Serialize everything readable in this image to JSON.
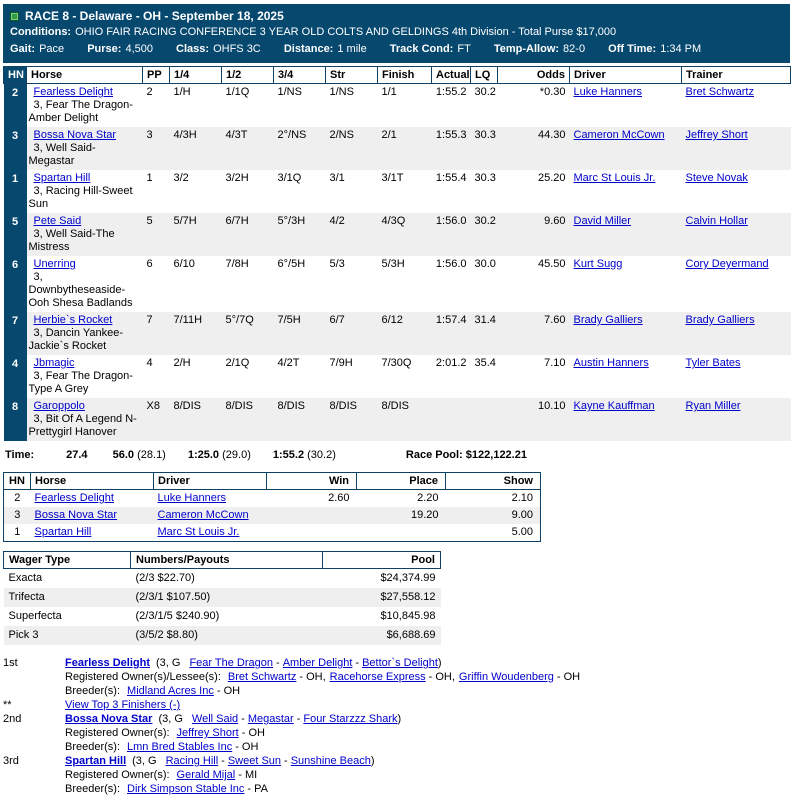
{
  "colors": {
    "navy": "#07486f",
    "link_blue": "#0000cc",
    "alt_row": "#efefef",
    "green_marker": "#2f9e43"
  },
  "header": {
    "race_title": "RACE 8 - Delaware - OH - September 18, 2025",
    "conditions_label": "Conditions:",
    "conditions": "OHIO FAIR RACING CONFERENCE 3 YEAR OLD COLTS AND GELDINGS 4th Division - Total Purse $17,000",
    "info": [
      {
        "label": "Gait:",
        "value": "Pace"
      },
      {
        "label": "Purse:",
        "value": "4,500"
      },
      {
        "label": "Class:",
        "value": "OHFS 3C"
      },
      {
        "label": "Distance:",
        "value": "1 mile"
      },
      {
        "label": "Track Cond:",
        "value": "FT"
      },
      {
        "label": "Temp-Allow:",
        "value": "82-0"
      },
      {
        "label": "Off Time:",
        "value": "1:34 PM"
      }
    ]
  },
  "results": {
    "headers": {
      "hn": "HN",
      "horse": "Horse",
      "pp": "PP",
      "q1": "1/4",
      "q2": "1/2",
      "q3": "3/4",
      "str": "Str",
      "finish": "Finish",
      "actual": "Actual",
      "lq": "LQ",
      "odds": "Odds",
      "driver": "Driver",
      "trainer": "Trainer"
    },
    "rows": [
      {
        "hn": "2",
        "name": "Fearless Delight",
        "ped": "3, Fear The Dragon-Amber Delight",
        "pp": "2",
        "q1": "1/H",
        "q2": "1/1Q",
        "q3": "1/NS",
        "str": "1/NS",
        "finish": "1/1",
        "actual": "1:55.2",
        "lq": "30.2",
        "odds": "*0.30",
        "driver": "Luke Hanners",
        "trainer": "Bret Schwartz"
      },
      {
        "hn": "3",
        "name": "Bossa Nova Star",
        "ped": "3, Well Said-Megastar",
        "pp": "3",
        "q1": "4/3H",
        "q2": "4/3T",
        "q3": "2°/NS",
        "str": "2/NS",
        "finish": "2/1",
        "actual": "1:55.3",
        "lq": "30.3",
        "odds": "44.30",
        "driver": "Cameron McCown",
        "trainer": "Jeffrey Short"
      },
      {
        "hn": "1",
        "name": "Spartan Hill",
        "ped": "3, Racing Hill-Sweet Sun",
        "pp": "1",
        "q1": "3/2",
        "q2": "3/2H",
        "q3": "3/1Q",
        "str": "3/1",
        "finish": "3/1T",
        "actual": "1:55.4",
        "lq": "30.3",
        "odds": "25.20",
        "driver": "Marc St Louis Jr.",
        "trainer": "Steve Novak"
      },
      {
        "hn": "5",
        "name": "Pete Said",
        "ped": "3, Well Said-The Mistress",
        "pp": "5",
        "q1": "5/7H",
        "q2": "6/7H",
        "q3": "5°/3H",
        "str": "4/2",
        "finish": "4/3Q",
        "actual": "1:56.0",
        "lq": "30.2",
        "odds": "9.60",
        "driver": "David Miller",
        "trainer": "Calvin Hollar"
      },
      {
        "hn": "6",
        "name": "Unerring",
        "ped": "3, Downbytheseaside-Ooh Shesa Badlands",
        "pp": "6",
        "q1": "6/10",
        "q2": "7/8H",
        "q3": "6°/5H",
        "str": "5/3",
        "finish": "5/3H",
        "actual": "1:56.0",
        "lq": "30.0",
        "odds": "45.50",
        "driver": "Kurt Sugg",
        "trainer": "Cory Deyermand"
      },
      {
        "hn": "7",
        "name": "Herbie`s Rocket",
        "ped": "3, Dancin Yankee-Jackie`s Rocket",
        "pp": "7",
        "q1": "7/11H",
        "q2": "5°/7Q",
        "q3": "7/5H",
        "str": "6/7",
        "finish": "6/12",
        "actual": "1:57.4",
        "lq": "31.4",
        "odds": "7.60",
        "driver": "Brady Galliers",
        "trainer": "Brady Galliers"
      },
      {
        "hn": "4",
        "name": "Jbmagic",
        "ped": "3, Fear The Dragon-Type A Grey",
        "pp": "4",
        "q1": "2/H",
        "q2": "2/1Q",
        "q3": "4/2T",
        "str": "7/9H",
        "finish": "7/30Q",
        "actual": "2:01.2",
        "lq": "35.4",
        "odds": "7.10",
        "driver": "Austin Hanners",
        "trainer": "Tyler Bates"
      },
      {
        "hn": "8",
        "name": "Garoppolo",
        "ped": "3, Bit Of A Legend N-Prettygirl Hanover",
        "pp": "X8",
        "q1": "8/DIS",
        "q2": "8/DIS",
        "q3": "8/DIS",
        "str": "8/DIS",
        "finish": "8/DIS",
        "actual": "",
        "lq": "",
        "odds": "10.10",
        "driver": "Kayne Kauffman",
        "trainer": "Ryan Miller"
      }
    ]
  },
  "time_row": {
    "label": "Time:",
    "splits": [
      {
        "t": "27.4",
        "s": ""
      },
      {
        "t": "56.0",
        "s": "(28.1)"
      },
      {
        "t": "1:25.0",
        "s": "(29.0)"
      },
      {
        "t": "1:55.2",
        "s": "(30.2)"
      }
    ],
    "pool": "Race Pool: $122,122.21"
  },
  "payouts": {
    "headers": {
      "hn": "HN",
      "horse": "Horse",
      "driver": "Driver",
      "win": "Win",
      "place": "Place",
      "show": "Show"
    },
    "rows": [
      {
        "hn": "2",
        "horse": "Fearless Delight",
        "driver": "Luke Hanners",
        "win": "2.60",
        "place": "2.20",
        "show": "2.10"
      },
      {
        "hn": "3",
        "horse": "Bossa Nova Star",
        "driver": "Cameron McCown",
        "win": "",
        "place": "19.20",
        "show": "9.00"
      },
      {
        "hn": "1",
        "horse": "Spartan Hill",
        "driver": "Marc St Louis Jr.",
        "win": "",
        "place": "",
        "show": "5.00"
      }
    ]
  },
  "wagers": {
    "headers": {
      "type": "Wager Type",
      "numbers": "Numbers/Payouts",
      "pool": "Pool"
    },
    "rows": [
      {
        "type": "Exacta",
        "numbers": "(2/3 $22.70)",
        "pool": "$24,374.99"
      },
      {
        "type": "Trifecta",
        "numbers": "(2/3/1 $107.50)",
        "pool": "$27,558.12"
      },
      {
        "type": "Superfecta",
        "numbers": "(2/3/1/5 $240.90)",
        "pool": "$10,845.98"
      },
      {
        "type": "Pick 3",
        "numbers": "(3/5/2 $8.80)",
        "pool": "$6,688.69"
      }
    ]
  },
  "finishers": {
    "sep": "-",
    "view_top": {
      "rank": "**",
      "label": "View Top 3 Finishers (-)"
    },
    "entries": [
      {
        "rank": "1st",
        "name": "Fearless Delight",
        "open": "(3, G",
        "sire": "Fear The Dragon",
        "dam": "Amber Delight",
        "damsire": "Bettor`s Delight",
        "close": ")",
        "owner_label": "Registered Owner(s)/Lessee(s):",
        "owners": [
          {
            "name": "Bret Schwartz",
            "after": "- OH,"
          },
          {
            "name": "Racehorse Express",
            "after": "- OH,"
          },
          {
            "name": "Griffin Woudenberg",
            "after": "- OH"
          }
        ],
        "breeder_label": "Breeder(s):",
        "breeder": "Midland Acres Inc",
        "breeder_after": "- OH"
      },
      {
        "rank": "2nd",
        "name": "Bossa Nova Star",
        "open": "(3, G",
        "sire": "Well Said",
        "dam": "Megastar",
        "damsire": "Four Starzzz Shark",
        "close": ")",
        "owner_label": "Registered Owner(s):",
        "owners": [
          {
            "name": "Jeffrey Short",
            "after": "- OH"
          }
        ],
        "breeder_label": "Breeder(s):",
        "breeder": "Lmn Bred Stables Inc",
        "breeder_after": "- OH"
      },
      {
        "rank": "3rd",
        "name": "Spartan Hill",
        "open": "(3, G",
        "sire": "Racing Hill",
        "dam": "Sweet Sun",
        "damsire": "Sunshine Beach",
        "close": ")",
        "owner_label": "Registered Owner(s):",
        "owners": [
          {
            "name": "Gerald Mijal",
            "after": "- MI"
          }
        ],
        "breeder_label": "Breeder(s):",
        "breeder": "Dirk Simpson Stable Inc",
        "breeder_after": "- PA"
      }
    ]
  }
}
